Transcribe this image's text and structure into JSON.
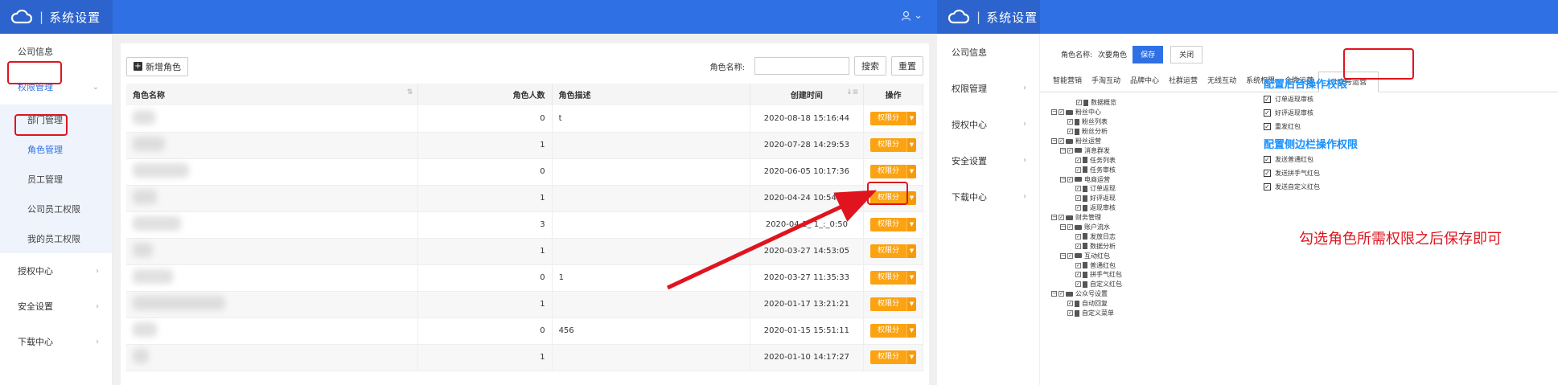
{
  "app": {
    "title": "系统设置"
  },
  "header": {
    "user_icon": "user-icon"
  },
  "left": {
    "sidebar": {
      "items": [
        {
          "label": "公司信息"
        },
        {
          "label": "权限管理"
        },
        {
          "label": "授权中心"
        },
        {
          "label": "安全设置"
        },
        {
          "label": "下载中心"
        }
      ],
      "subitems": [
        {
          "label": "部门管理"
        },
        {
          "label": "角色管理"
        },
        {
          "label": "员工管理"
        },
        {
          "label": "公司员工权限"
        },
        {
          "label": "我的员工权限"
        }
      ]
    },
    "toolbar": {
      "add_label": "新增角色",
      "search_label": "角色名称:",
      "search_placeholder": "",
      "search_button": "搜索",
      "reset_button": "重置"
    },
    "table": {
      "headers": [
        "角色名称",
        "角色人数",
        "角色描述",
        "创建时间",
        "操作"
      ],
      "rows": [
        {
          "count": "0",
          "desc": "t",
          "time": "2020-08-18 15:16:44"
        },
        {
          "count": "1",
          "desc": "",
          "time": "2020-07-28 14:29:53"
        },
        {
          "count": "0",
          "desc": "",
          "time": "2020-06-05 10:17:36"
        },
        {
          "count": "1",
          "desc": "",
          "time": "2020-04-24 10:54:47"
        },
        {
          "count": "3",
          "desc": "",
          "time": "2020-04-1_ 1_:_0:50"
        },
        {
          "count": "1",
          "desc": "",
          "time": "2020-03-27 14:53:05"
        },
        {
          "count": "0",
          "desc": "1",
          "time": "2020-03-27 11:35:33"
        },
        {
          "count": "1",
          "desc": "",
          "time": "2020-01-17 13:21:21"
        },
        {
          "count": "0",
          "desc": "456",
          "time": "2020-01-15 15:51:11"
        },
        {
          "count": "1",
          "desc": "",
          "time": "2020-01-10 14:17:27"
        }
      ],
      "op_label": "权限分配"
    }
  },
  "right": {
    "sidebar": {
      "items": [
        {
          "label": "公司信息"
        },
        {
          "label": "权限管理"
        },
        {
          "label": "授权中心"
        },
        {
          "label": "安全设置"
        },
        {
          "label": "下载中心"
        }
      ]
    },
    "head": {
      "role_label": "角色名称:",
      "role_value": "次要角色",
      "save": "保存",
      "close": "关闭"
    },
    "tabs": [
      "智能营销",
      "手淘互动",
      "品牌中心",
      "社群运营",
      "无线互动",
      "系统权限",
      "企微运营",
      "公众号运营"
    ],
    "tree": [
      {
        "level": 1,
        "label": "数据概览",
        "type": "file",
        "toggle": false
      },
      {
        "level": 0,
        "label": "粉丝中心",
        "type": "folder",
        "toggle": true
      },
      {
        "level": 1,
        "label": "粉丝列表",
        "type": "file",
        "toggle": false
      },
      {
        "level": 1,
        "label": "粉丝分析",
        "type": "file",
        "toggle": false
      },
      {
        "level": 0,
        "label": "粉丝运营",
        "type": "folder",
        "toggle": true
      },
      {
        "level": 1,
        "label": "消息群发",
        "type": "folder",
        "toggle": true
      },
      {
        "level": 2,
        "label": "任务列表",
        "type": "file",
        "toggle": false
      },
      {
        "level": 2,
        "label": "任务审核",
        "type": "file",
        "toggle": false
      },
      {
        "level": 1,
        "label": "电商运营",
        "type": "folder",
        "toggle": true
      },
      {
        "level": 2,
        "label": "订单返现",
        "type": "file",
        "toggle": false
      },
      {
        "level": 2,
        "label": "好评返现",
        "type": "file",
        "toggle": false
      },
      {
        "level": 2,
        "label": "返现审核",
        "type": "file",
        "toggle": false
      },
      {
        "level": 0,
        "label": "财务管理",
        "type": "folder",
        "toggle": true
      },
      {
        "level": 1,
        "label": "账户流水",
        "type": "folder",
        "toggle": true
      },
      {
        "level": 2,
        "label": "发放日志",
        "type": "file",
        "toggle": false
      },
      {
        "level": 2,
        "label": "数据分析",
        "type": "file",
        "toggle": false
      },
      {
        "level": 1,
        "label": "互动红包",
        "type": "folder",
        "toggle": true
      },
      {
        "level": 2,
        "label": "普通红包",
        "type": "file",
        "toggle": false
      },
      {
        "level": 2,
        "label": "拼手气红包",
        "type": "file",
        "toggle": false
      },
      {
        "level": 2,
        "label": "自定义红包",
        "type": "file",
        "toggle": false
      },
      {
        "level": 0,
        "label": "公众号设置",
        "type": "folder",
        "toggle": true
      },
      {
        "level": 1,
        "label": "自动回复",
        "type": "file",
        "toggle": false
      },
      {
        "level": 1,
        "label": "自定义菜单",
        "type": "file",
        "toggle": false
      }
    ],
    "backend_title": "配置后台操作权限",
    "backend_perms": [
      "订单返现审核",
      "好评返现审核",
      "重发红包"
    ],
    "sidebar_title": "配置侧边栏操作权限",
    "sidebar_perms": [
      "发送普通红包",
      "发送拼手气红包",
      "发送自定义红包"
    ],
    "note": "勾选角色所需权限之后保存即可"
  },
  "colors": {
    "header": "#2f71e4",
    "accent": "#2f71e4",
    "warn": "#fba313",
    "annotation": "#e0141e",
    "perm_title": "#1890ff"
  }
}
